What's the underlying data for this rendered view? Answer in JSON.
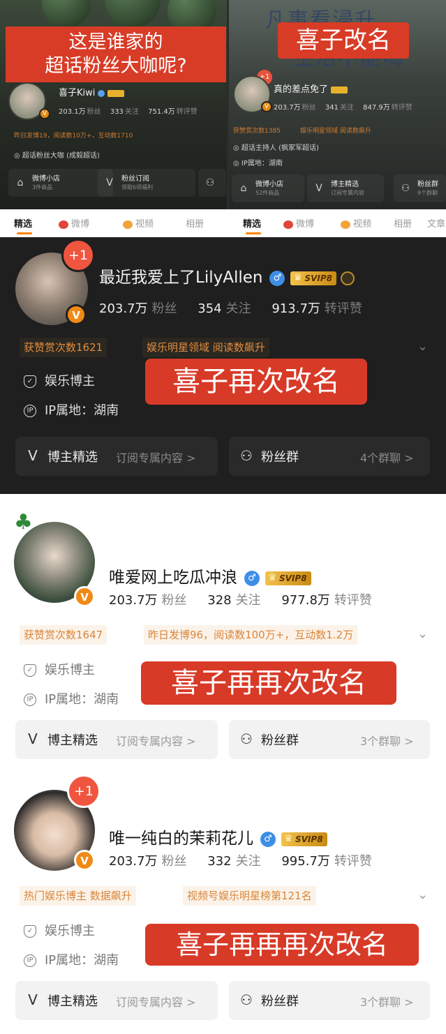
{
  "top_left": {
    "caption": [
      "这是谁家的",
      "超话粉丝大咖呢?"
    ],
    "name": "喜子Kiwi",
    "followers": "203.1万",
    "followers_label": "粉丝",
    "following": "333",
    "following_label": "关注",
    "interactions": "751.4万",
    "interactions_label": "转评赞",
    "activity": "昨日发博19，阅读数10万+，互动数1710",
    "role": "超话粉丝大咖 (成毅超话)",
    "cards": [
      {
        "title": "微博小店",
        "sub": "3件商品"
      },
      {
        "title": "粉丝订阅",
        "sub": "领取6项福利"
      }
    ]
  },
  "top_right": {
    "handwriting": [
      "凡事看浸升",
      "生活不能嗨"
    ],
    "caption": "喜子改名",
    "plus": "+1",
    "name": "真的差点免了",
    "followers": "203.7万",
    "followers_label": "粉丝",
    "following": "341",
    "following_label": "关注",
    "interactions": "847.9万",
    "interactions_label": "转评赞",
    "chips": [
      "获赞赏次数1385",
      "娱乐明星领域 阅读数飙升"
    ],
    "role": "超话主持人 (枫家军超话)",
    "ip": "IP属地：湖南",
    "cards": [
      {
        "title": "微博小店",
        "sub": "52件商品"
      },
      {
        "title": "博主精选",
        "sub": "订阅专属内容"
      },
      {
        "title": "粉丝群",
        "sub": "9个群聊"
      }
    ]
  },
  "tabs_left": [
    "精选",
    "微博",
    "视频",
    "相册"
  ],
  "tabs_right": [
    "精选",
    "微博",
    "视频",
    "相册",
    "文章"
  ],
  "profile_1": {
    "plus": "+1",
    "name": "最近我爱上了LilyAllen",
    "svip": "SVIP8",
    "followers": "203.7万",
    "followers_label": "粉丝",
    "following": "354",
    "following_label": "关注",
    "interactions": "913.7万",
    "interactions_label": "转评赞",
    "chips": [
      "获赞赏次数1621",
      "娱乐明星领域 阅读数飙升"
    ],
    "role": "娱乐博主",
    "ip": "IP属地：湖南",
    "caption": "喜子再次改名",
    "card_left_title": "博主精选",
    "card_left_sub": "订阅专属内容 >",
    "card_right_title": "粉丝群",
    "card_right_sub": "4个群聊 >"
  },
  "profile_2": {
    "name": "唯爱网上吃瓜冲浪",
    "svip": "SVIP8",
    "followers": "203.7万",
    "followers_label": "粉丝",
    "following": "328",
    "following_label": "关注",
    "interactions": "977.8万",
    "interactions_label": "转评赞",
    "chips": [
      "获赞赏次数1647",
      "昨日发博96，阅读数100万+，互动数1.2万"
    ],
    "role": "娱乐博主",
    "ip": "IP属地：湖南",
    "caption": "喜子再再次改名",
    "card_left_title": "博主精选",
    "card_left_sub": "订阅专属内容 >",
    "card_right_title": "粉丝群",
    "card_right_sub": "3个群聊 >"
  },
  "profile_3": {
    "plus": "+1",
    "name": "唯一纯白的茉莉花儿",
    "svip": "SVIP8",
    "followers": "203.7万",
    "followers_label": "粉丝",
    "following": "332",
    "following_label": "关注",
    "interactions": "995.7万",
    "interactions_label": "转评赞",
    "chips": [
      "热门娱乐博主 数据飙升",
      "视频号娱乐明星榜第121名"
    ],
    "role": "娱乐博主",
    "ip": "IP属地：湖南",
    "caption": "喜子再再再次改名",
    "card_left_title": "博主精选",
    "card_left_sub": "订阅专属内容 >",
    "card_right_title": "粉丝群",
    "card_right_sub": "3个群聊 >"
  },
  "colors": {
    "accent_red": "#d83a28",
    "orange": "#f08a16",
    "verified_blue": "#3e8ee6"
  }
}
